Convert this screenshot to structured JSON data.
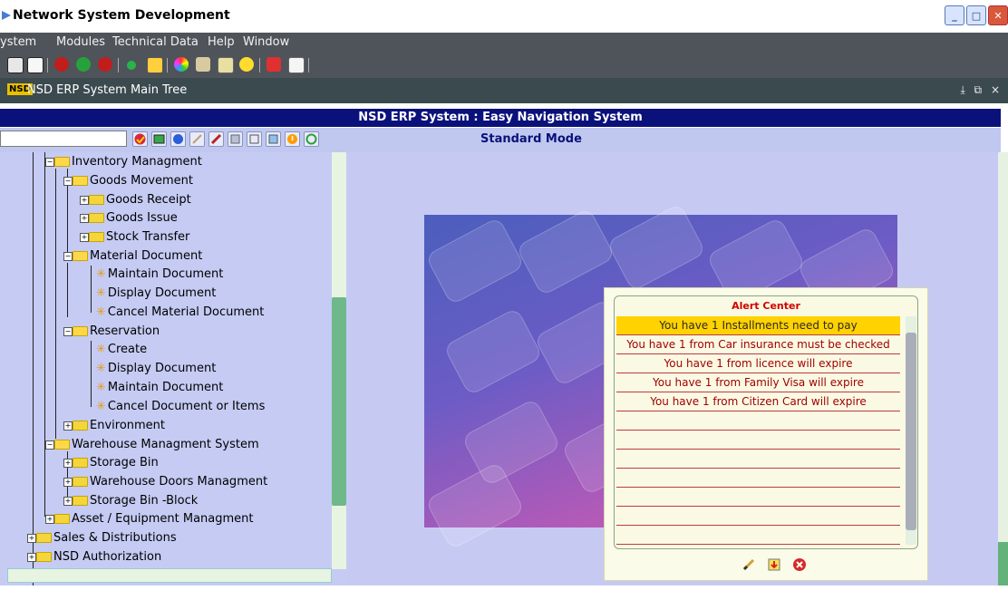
{
  "window": {
    "title": "Network System Development",
    "controls": [
      "minimize",
      "maximize",
      "close"
    ]
  },
  "menu": {
    "items": [
      "ystem",
      "Modules",
      "Technical Data",
      "Help",
      "Window"
    ]
  },
  "inner_window": {
    "logo": "NSD",
    "title": "NSD ERP System Main Tree"
  },
  "header": {
    "title": "NSD ERP System : Easy Navigation System"
  },
  "mode_bar": {
    "search_value": "",
    "mode_label": "Standard Mode"
  },
  "tree": {
    "nodes": [
      {
        "label": "Inventory Managment",
        "type": "folder-open"
      },
      {
        "label": "Goods Movement",
        "type": "folder-open"
      },
      {
        "label": "Goods Receipt",
        "type": "folder"
      },
      {
        "label": "Goods Issue",
        "type": "folder"
      },
      {
        "label": "Stock Transfer",
        "type": "folder"
      },
      {
        "label": "Material Document",
        "type": "folder-open"
      },
      {
        "label": "Maintain  Document",
        "type": "leaf"
      },
      {
        "label": "Display Document",
        "type": "leaf"
      },
      {
        "label": "Cancel Material Document",
        "type": "leaf"
      },
      {
        "label": "Reservation",
        "type": "folder-open"
      },
      {
        "label": "Create",
        "type": "leaf"
      },
      {
        "label": "Display Document",
        "type": "leaf"
      },
      {
        "label": "Maintain Document",
        "type": "leaf"
      },
      {
        "label": "Cancel Document or Items",
        "type": "leaf"
      },
      {
        "label": "Environment",
        "type": "folder"
      },
      {
        "label": "Warehouse Managment System",
        "type": "folder-open"
      },
      {
        "label": "Storage Bin",
        "type": "folder"
      },
      {
        "label": "Warehouse Doors Managment",
        "type": "folder"
      },
      {
        "label": "Storage Bin -Block",
        "type": "folder"
      },
      {
        "label": "Asset / Equipment Managment",
        "type": "folder"
      },
      {
        "label": "Sales & Distributions",
        "type": "folder"
      },
      {
        "label": "NSD Authorization",
        "type": "folder"
      }
    ]
  },
  "alert_center": {
    "title": "Alert Center",
    "alerts": [
      "You have 1 Installments need to pay",
      "You have  1  from Car insurance must be checked",
      "You have 1 from licence will expire",
      "You have 1 from Family Visa will expire",
      "You have 1 from Citizen Card will expire"
    ],
    "selected_index": 0,
    "colors": {
      "selected": "#ffd200",
      "text": "#a30000"
    }
  },
  "colors": {
    "header_bg": "#0a117a",
    "tree_bg": "#c5cbf3",
    "menubar_bg": "#4f545a"
  }
}
